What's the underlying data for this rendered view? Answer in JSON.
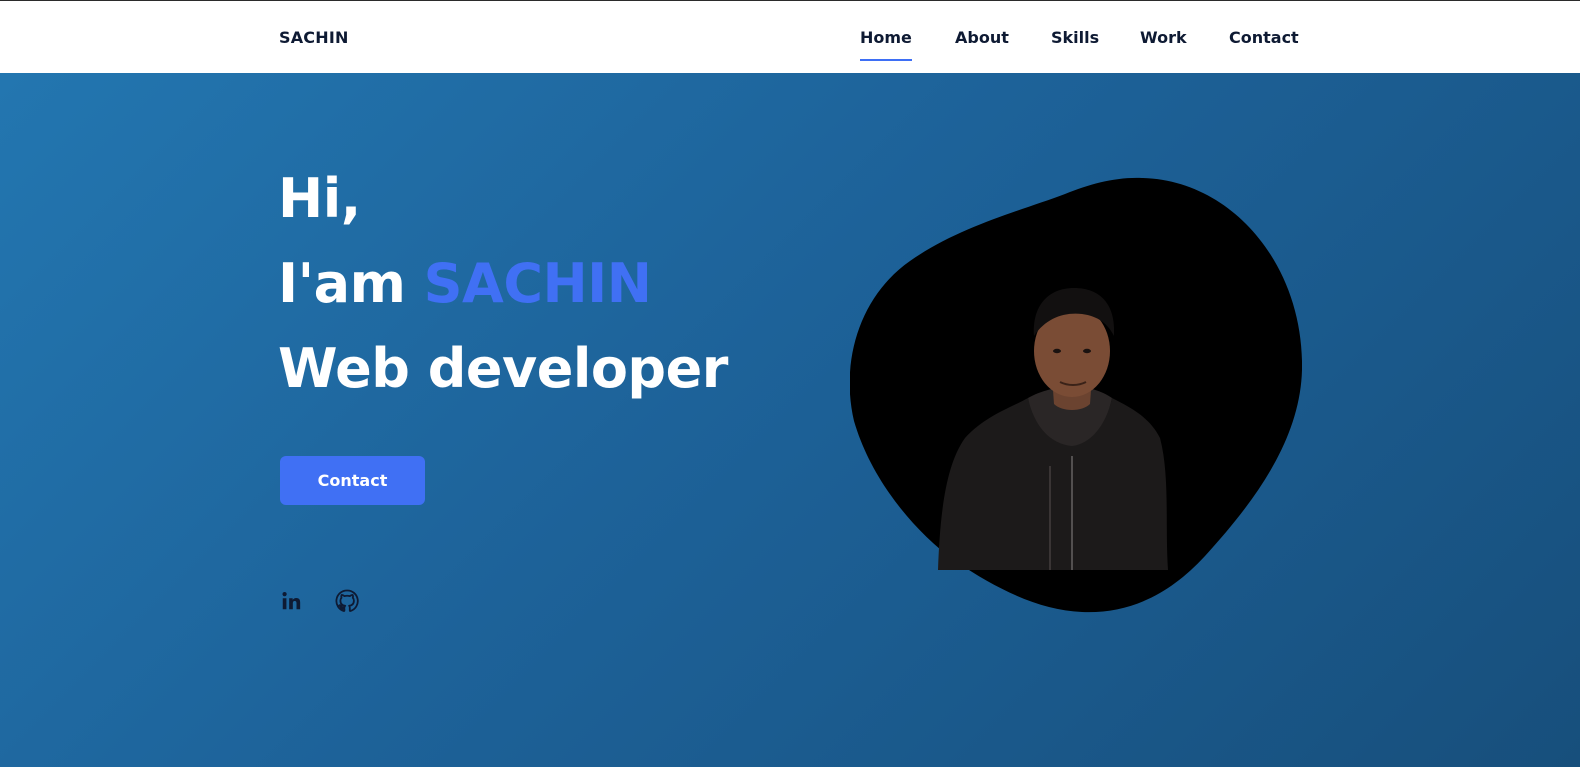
{
  "header": {
    "logo": "SACHIN",
    "nav": [
      {
        "label": "Home",
        "active": true
      },
      {
        "label": "About",
        "active": false
      },
      {
        "label": "Skills",
        "active": false
      },
      {
        "label": "Work",
        "active": false
      },
      {
        "label": "Contact",
        "active": false
      }
    ]
  },
  "hero": {
    "greeting": "Hi,",
    "intro_prefix": "I'am",
    "name": "SACHIN",
    "role": "Web developer",
    "contact_button": "Contact",
    "social": [
      {
        "icon": "linkedin-icon"
      },
      {
        "icon": "github-icon"
      }
    ]
  },
  "colors": {
    "accent": "#4070f4",
    "hero_bg_start": "#2376b0",
    "hero_bg_end": "#174f7c",
    "nav_text": "#0e1a33"
  }
}
